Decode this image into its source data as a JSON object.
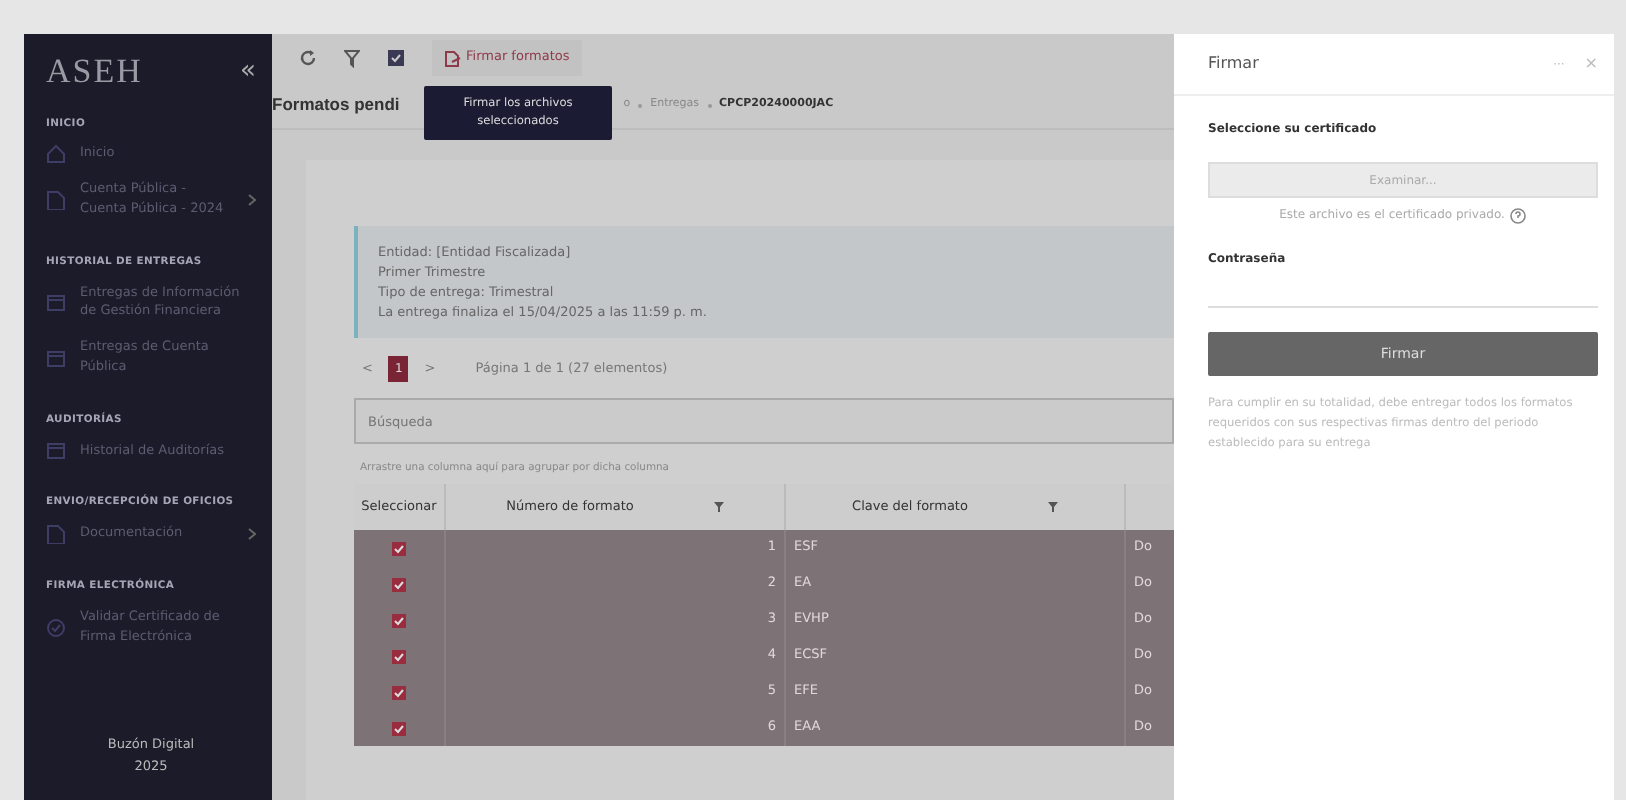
{
  "sidebar": {
    "logo": "ASEH",
    "collapse": "«",
    "sections": [
      {
        "heading": "INICIO",
        "items": [
          {
            "label": "Inicio",
            "kind": "home",
            "submenu": false
          },
          {
            "label": "Cuenta Pública - Cuenta Pública - 2024",
            "kind": "file",
            "submenu": true
          }
        ]
      },
      {
        "heading": "HISTORIAL DE ENTREGAS",
        "items": [
          {
            "label": "Entregas de Información de Gestión Financiera",
            "kind": "calendar",
            "submenu": false
          },
          {
            "label": "Entregas de Cuenta Pública",
            "kind": "calendar",
            "submenu": false
          }
        ]
      },
      {
        "heading": "AUDITORÍAS",
        "items": [
          {
            "label": "Historial de Auditorías",
            "kind": "calendar",
            "submenu": false
          }
        ]
      },
      {
        "heading": "ENVIO/RECEPCIÓN DE OFICIOS",
        "items": [
          {
            "label": "Documentación",
            "kind": "file",
            "submenu": true
          }
        ]
      },
      {
        "heading": "FIRMA ELECTRÓNICA",
        "items": [
          {
            "label": "Validar Certificado de Firma Electrónica",
            "kind": "check",
            "submenu": false
          }
        ]
      }
    ],
    "footer": [
      "Buzón Digital",
      "2025"
    ]
  },
  "toolbar": {
    "sign_button": "Firmar formatos",
    "tooltip": "Firmar los archivos seleccionados"
  },
  "page": {
    "title": "Formatos pendi",
    "breadcrumb": [
      "o",
      "Entregas",
      "CPCP20240000JAC"
    ]
  },
  "info": [
    "Entidad: [Entidad Fiscalizada]",
    "Primer Trimestre",
    "Tipo de entrega: Trimestral",
    "La entrega finaliza el 15/04/2025 a las 11:59 p. m."
  ],
  "pager": {
    "prev": "<",
    "page": "1",
    "next": ">",
    "summary": "Página 1 de 1 (27 elementos)"
  },
  "search": {
    "placeholder": "Búsqueda"
  },
  "group_hint": "Arrastre una columna aquí para agrupar por dicha columna",
  "table": {
    "columns": [
      {
        "label": "Seleccionar",
        "filter": false
      },
      {
        "label": "Número de formato",
        "filter": true
      },
      {
        "label": "Clave del formato",
        "filter": true
      }
    ],
    "rows": [
      {
        "checked": true,
        "number": "1",
        "key": "ESF",
        "column_4": "Do"
      },
      {
        "checked": true,
        "number": "2",
        "key": "EA",
        "column_4": "Do"
      },
      {
        "checked": true,
        "number": "3",
        "key": "EVHP",
        "column_4": "Do"
      },
      {
        "checked": true,
        "number": "4",
        "key": "ECSF",
        "column_4": "Do"
      },
      {
        "checked": true,
        "number": "5",
        "key": "EFE",
        "column_4": "Do"
      },
      {
        "checked": true,
        "number": "6",
        "key": "EAA",
        "column_4": "Do"
      }
    ]
  },
  "drawer": {
    "title": "Firmar",
    "more": "···",
    "close": "×",
    "cert_label": "Seleccione su certificado",
    "browse": "Examinar...",
    "cert_help": "Este archivo es el certificado privado.",
    "password_label": "Contraseña",
    "submit": "Firmar",
    "note": "Para cumplir en su totalidad, debe entregar todos los formatos requeridos con sus respectivas firmas dentro del periodo establecido para su entrega"
  }
}
